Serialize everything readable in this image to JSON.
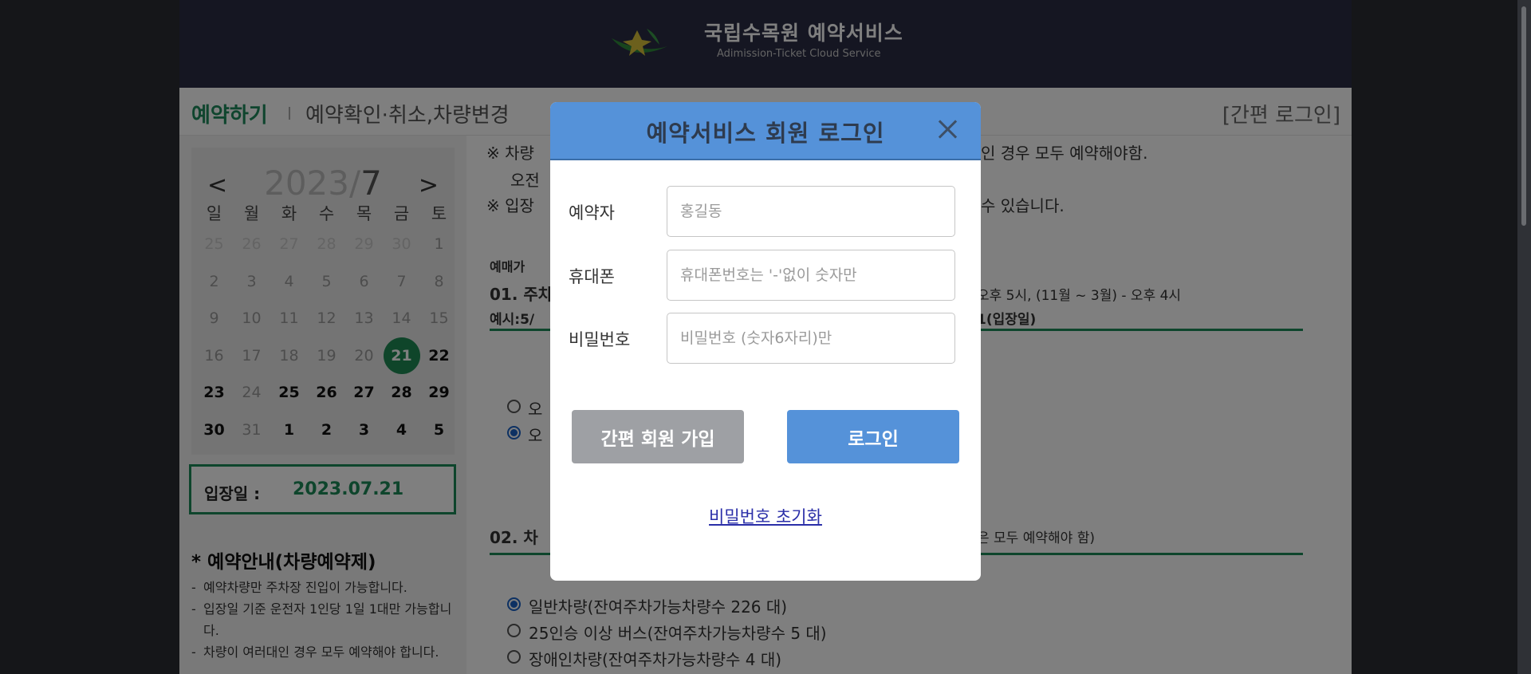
{
  "header": {
    "title": "국립수목원 예약서비스",
    "subtitle": "Adimission-Ticket Cloud Service"
  },
  "nav": {
    "reserve": "예약하기",
    "check": "예약확인·취소,차량변경",
    "quick_login": "[간편 로그인]"
  },
  "calendar": {
    "prev": "<",
    "next": ">",
    "year": "2023/",
    "month": "7",
    "weekdays": [
      "일",
      "월",
      "화",
      "수",
      "목",
      "금",
      "토"
    ],
    "days": [
      {
        "d": "25",
        "s": "out"
      },
      {
        "d": "26",
        "s": "out"
      },
      {
        "d": "27",
        "s": "out"
      },
      {
        "d": "28",
        "s": "out"
      },
      {
        "d": "29",
        "s": "out"
      },
      {
        "d": "30",
        "s": "out"
      },
      {
        "d": "1",
        "s": "past"
      },
      {
        "d": "2",
        "s": "past"
      },
      {
        "d": "3",
        "s": "past"
      },
      {
        "d": "4",
        "s": "past"
      },
      {
        "d": "5",
        "s": "past"
      },
      {
        "d": "6",
        "s": "past"
      },
      {
        "d": "7",
        "s": "past"
      },
      {
        "d": "8",
        "s": "past"
      },
      {
        "d": "9",
        "s": "past"
      },
      {
        "d": "10",
        "s": "past"
      },
      {
        "d": "11",
        "s": "past"
      },
      {
        "d": "12",
        "s": "past"
      },
      {
        "d": "13",
        "s": "past"
      },
      {
        "d": "14",
        "s": "past"
      },
      {
        "d": "15",
        "s": "past"
      },
      {
        "d": "16",
        "s": "past"
      },
      {
        "d": "17",
        "s": "past"
      },
      {
        "d": "18",
        "s": "past"
      },
      {
        "d": "19",
        "s": "past"
      },
      {
        "d": "20",
        "s": "past"
      },
      {
        "d": "21",
        "s": "today"
      },
      {
        "d": "22",
        "s": "avail"
      },
      {
        "d": "23",
        "s": "avail"
      },
      {
        "d": "24",
        "s": "past"
      },
      {
        "d": "25",
        "s": "avail"
      },
      {
        "d": "26",
        "s": "avail"
      },
      {
        "d": "27",
        "s": "avail"
      },
      {
        "d": "28",
        "s": "avail"
      },
      {
        "d": "29",
        "s": "avail"
      },
      {
        "d": "30",
        "s": "avail"
      },
      {
        "d": "31",
        "s": "past"
      },
      {
        "d": "1",
        "s": "avail"
      },
      {
        "d": "2",
        "s": "avail"
      },
      {
        "d": "3",
        "s": "avail"
      },
      {
        "d": "4",
        "s": "avail"
      },
      {
        "d": "5",
        "s": "avail"
      }
    ]
  },
  "entry": {
    "label": "입장일 :",
    "date": "2023.07.21"
  },
  "notice": {
    "title": "* 예약안내(차량예약제)",
    "items": [
      "예약차량만 주차장 진입이 가능합니다.",
      "입장일 기준 운전자 1인당 1일 1대만 가능합니다.",
      "차량이 여러대인 경우 모두 예약해야 합니다."
    ]
  },
  "content": {
    "note1_a": "※ 차량",
    "note1_b": "인 경우 모두 예약해야함.",
    "note1_c": "오전",
    "note2_a": "※ 입장",
    "note2_b": "수 있습니다.",
    "period_label": "예매가",
    "sec1_a": "01. 주차",
    "sec1_b": "오후 5시, (11월 ~ 3월) - 오후 4시",
    "example_a": "예시:5/",
    "example_b": "1(입장일)",
    "opt1": "오",
    "opt2": "오",
    "sec2_a": "02. 차",
    "sec2_b": "은 모두 예약해야 함)",
    "vehicles": [
      "일반차량(잔여주차가능차량수 226 대)",
      "25인승 이상 버스(잔여주차가능차량수 5 대)",
      "장애인차량(잔여주차가능차량수 4 대)"
    ]
  },
  "modal": {
    "title": "예약서비스 회원 로그인",
    "fields": {
      "name_label": "예약자",
      "name_placeholder": "홍길동",
      "phone_label": "휴대폰",
      "phone_placeholder": "휴대폰번호는 '-'없이 숫자만",
      "pw_label": "비밀번호",
      "pw_placeholder": "비밀번호 (숫자6자리)만"
    },
    "signup_button": "간편 회원 가입",
    "login_button": "로그인",
    "reset_link": "비밀번호 초기화"
  },
  "colors": {
    "brand_green": "#1d8a59",
    "modal_header": "#5592d9",
    "signup_gray": "#9ea0a4",
    "header_navy": "#2a2c45"
  }
}
